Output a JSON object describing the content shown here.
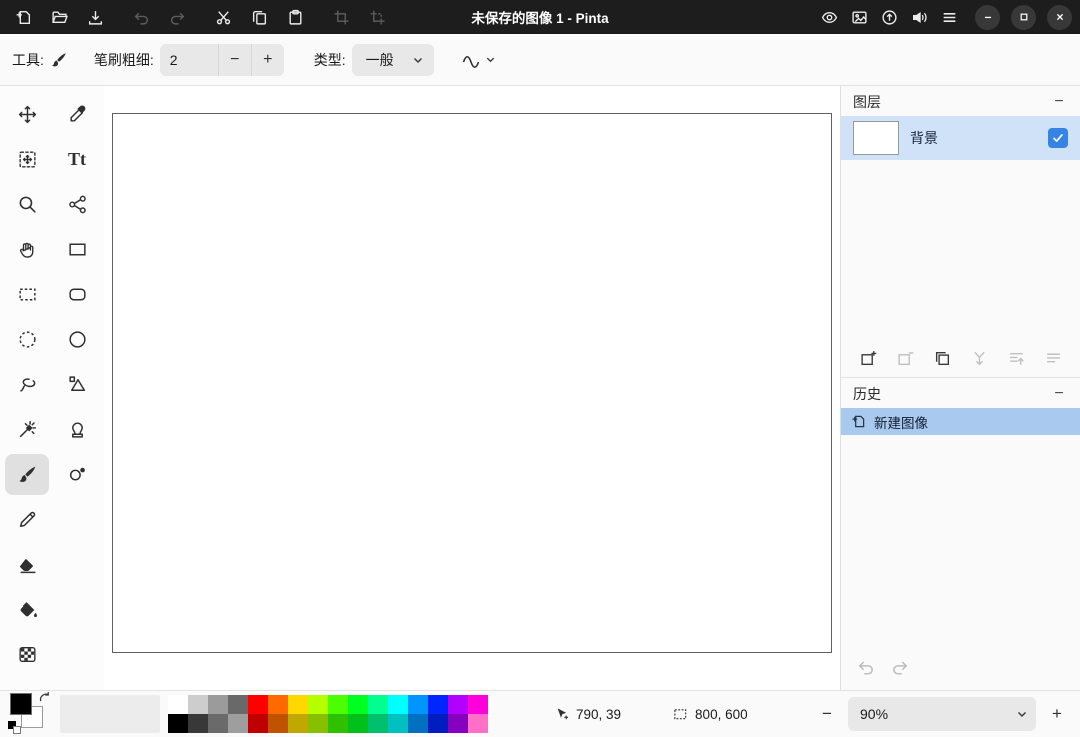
{
  "window": {
    "title": "未保存的图像 1 - Pinta",
    "controls": [
      "minimize",
      "maximize",
      "close"
    ]
  },
  "header": {
    "left_icons": [
      "new-image",
      "open",
      "save",
      "undo",
      "redo",
      "cut",
      "copy",
      "paste",
      "crop",
      "crop-to-selection"
    ],
    "disabled_icons": [
      "undo",
      "redo",
      "crop",
      "crop-to-selection"
    ],
    "right_icons": [
      "eye",
      "screenshot",
      "updates",
      "audio",
      "main-menu"
    ]
  },
  "toolbar": {
    "tool_label": "工具:",
    "current_tool_icon": "paintbrush-icon",
    "brush_width_label": "笔刷粗细:",
    "brush_width_value": "2",
    "decrease_label": "−",
    "increase_label": "+",
    "type_label": "类型:",
    "type_value": "一般",
    "stroke_style_icon": "squiggle-icon"
  },
  "tools": {
    "selected": "paintbrush",
    "text_icon_glyph": "Tt",
    "column_1": [
      "move-selected",
      "move-selection",
      "zoom",
      "pan",
      "rectangle-select",
      "ellipse-select",
      "lasso-select",
      "magic-wand",
      "paintbrush",
      "pencil",
      "eraser",
      "paint-bucket",
      "gradient"
    ],
    "column_2": [
      "color-picker",
      "text",
      "line-curve",
      "rectangle",
      "rounded-rectangle",
      "ellipse",
      "freeform-shape",
      "clone-stamp",
      "recolor"
    ]
  },
  "layers_panel": {
    "title": "图层",
    "collapse_label": "−",
    "layers": [
      {
        "name": "背景",
        "visible": true,
        "selected": true
      }
    ],
    "actions": [
      "add-layer",
      "delete-layer",
      "duplicate-layer",
      "merge-layer-down",
      "move-layer-up",
      "layer-properties"
    ],
    "disabled_actions": [
      "delete-layer",
      "merge-layer-down",
      "move-layer-up",
      "layer-properties"
    ]
  },
  "history_panel": {
    "title": "历史",
    "collapse_label": "−",
    "items": [
      {
        "label": "新建图像",
        "selected": true
      }
    ]
  },
  "status_bar": {
    "cursor_position": "790, 39",
    "canvas_size": "800, 600",
    "zoom_out_label": "−",
    "zoom_in_label": "+",
    "zoom_value": "90%",
    "primary_color": "#000000",
    "secondary_color": "#ffffff",
    "palette_rows": [
      [
        "#ffffff",
        "#cdcdcd",
        "#9b9b9b",
        "#696969",
        "#ff0000",
        "#ff6a00",
        "#ffd800",
        "#b6ff00",
        "#4cff00",
        "#00ff21",
        "#00ff90",
        "#00ffff",
        "#0094ff",
        "#0026ff",
        "#b200ff",
        "#ff00dc"
      ],
      [
        "#000000",
        "#383838",
        "#6a6a6a",
        "#9e9e9e",
        "#c00000",
        "#c05300",
        "#c0a800",
        "#86c000",
        "#2fc000",
        "#00c019",
        "#00c06d",
        "#00c0c0",
        "#0070c0",
        "#001dc0",
        "#8600c0",
        "#ff6ec7"
      ]
    ]
  },
  "accent_color": "#3584e4"
}
